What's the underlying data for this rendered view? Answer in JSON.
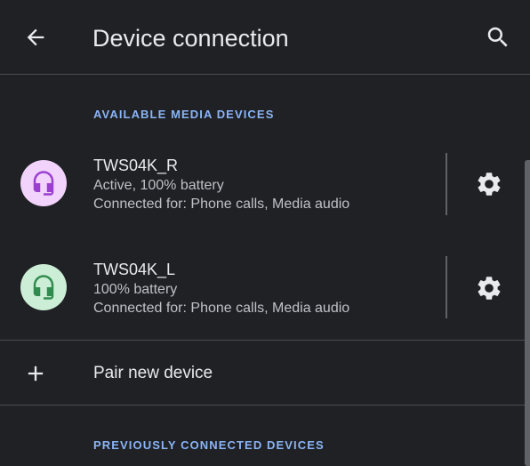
{
  "app_bar": {
    "title": "Device connection",
    "back_icon": "arrow-back-icon",
    "search_icon": "search-icon"
  },
  "sections": {
    "available": "AVAILABLE MEDIA DEVICES",
    "previous": "PREVIOUSLY CONNECTED DEVICES"
  },
  "devices": [
    {
      "name": "TWS04K_R",
      "status": "Active, 100% battery",
      "connected_for": "Connected for: Phone calls, Media audio",
      "icon": "headset-icon",
      "icon_bg": "#f2d3fb",
      "icon_color": "#9b3fd0"
    },
    {
      "name": "TWS04K_L",
      "status": "100% battery",
      "connected_for": "Connected for: Phone calls, Media audio",
      "icon": "headset-icon",
      "icon_bg": "#cdeed6",
      "icon_color": "#2f8b4e"
    }
  ],
  "pair": {
    "label": "Pair new device",
    "icon": "plus-icon"
  },
  "colors": {
    "background": "#202124",
    "accent": "#8ab4f8",
    "text_primary": "#e8eaed",
    "text_secondary": "#bdc1c6"
  }
}
